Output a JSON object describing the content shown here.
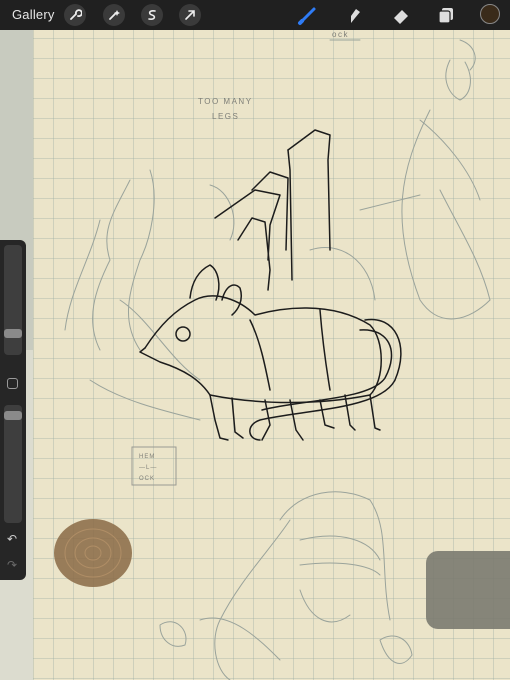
{
  "toolbar": {
    "gallery_label": "Gallery",
    "tools": [
      "wrench-icon",
      "magic-wand-icon",
      "selection-icon",
      "transform-arrow-icon"
    ],
    "right_tools": [
      "brush-icon",
      "smudge-icon",
      "eraser-icon",
      "layers-icon"
    ],
    "active_color": "#3a2b1a",
    "active_tool_color": "#2f7cf6"
  },
  "canvas": {
    "note_top": [
      "TOO MANY",
      "LEGS"
    ],
    "stamp_lines": [
      "HEM",
      "—L—",
      "OCK"
    ],
    "corner_scrawl": "ock",
    "fingerprint_color": "#8a6a45",
    "swatch_color": "#7b7a70"
  }
}
